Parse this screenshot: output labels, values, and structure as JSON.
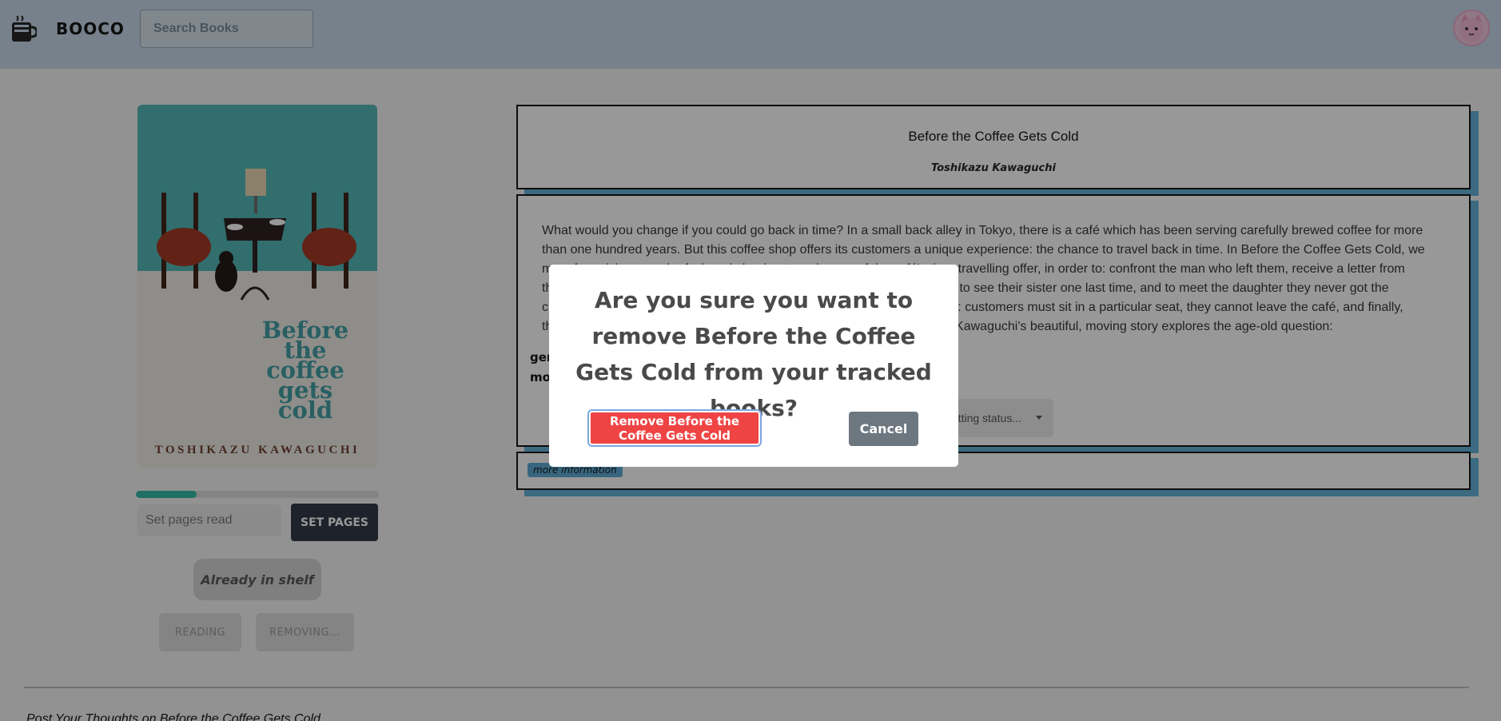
{
  "header": {
    "brand": "BOOCO",
    "search_placeholder": "Search Books",
    "logo_icon": "coffee-book-icon",
    "avatar_icon": "cat-avatar-icon"
  },
  "book": {
    "cover_title": "Before the coffee gets cold",
    "cover_author": "TOSHIKAZU KAWAGUCHI",
    "title": "Before the Coffee Gets Cold",
    "author": "Toshikazu Kawaguchi",
    "description": "What would you change if you could go back in time? In a small back alley in Tokyo, there is a café which has been serving carefully brewed coffee for more than one hundred years. But this coffee shop offers its customers a unique experience: the chance to travel back in time. In Before the Coffee Gets Cold, we meet four visitors, each of whom is hoping to make use of the café's time-travelling offer, in order to: confront the man who left them, receive a letter from their husband whose memory has been taken by early onset Alzheimer's, to see their sister one last time, and to meet the daughter they never got the chance to know. But the journey into the past does not come without risks: customers must sit in a particular seat, they cannot leave the café, and finally, they must return to the present before the coffee gets cold . . . Toshikazu Kawaguchi's beautiful, moving story explores the age-old question:"
  },
  "progress": {
    "read_fraction": 0.25,
    "color": "#2fb8a4"
  },
  "controls": {
    "pages_placeholder": "Set pages read",
    "set_pages_label": "SET PAGES",
    "shelf_label": "Already in shelf",
    "reading_label": "READING",
    "removing_label": "REMOVING..."
  },
  "details": {
    "genre_label": "genres:",
    "moods_label": "moods:",
    "status_placeholder": "Getting status...",
    "more_info_label": "more information"
  },
  "thoughts_label": "Post Your Thoughts on Before the Coffee Gets Cold",
  "modal": {
    "question": "Are you sure you want to remove Before the Coffee Gets Cold from your tracked books?",
    "remove_label": "Remove Before the Coffee Gets Cold",
    "cancel_label": "Cancel",
    "remove_color": "#ef4444"
  }
}
